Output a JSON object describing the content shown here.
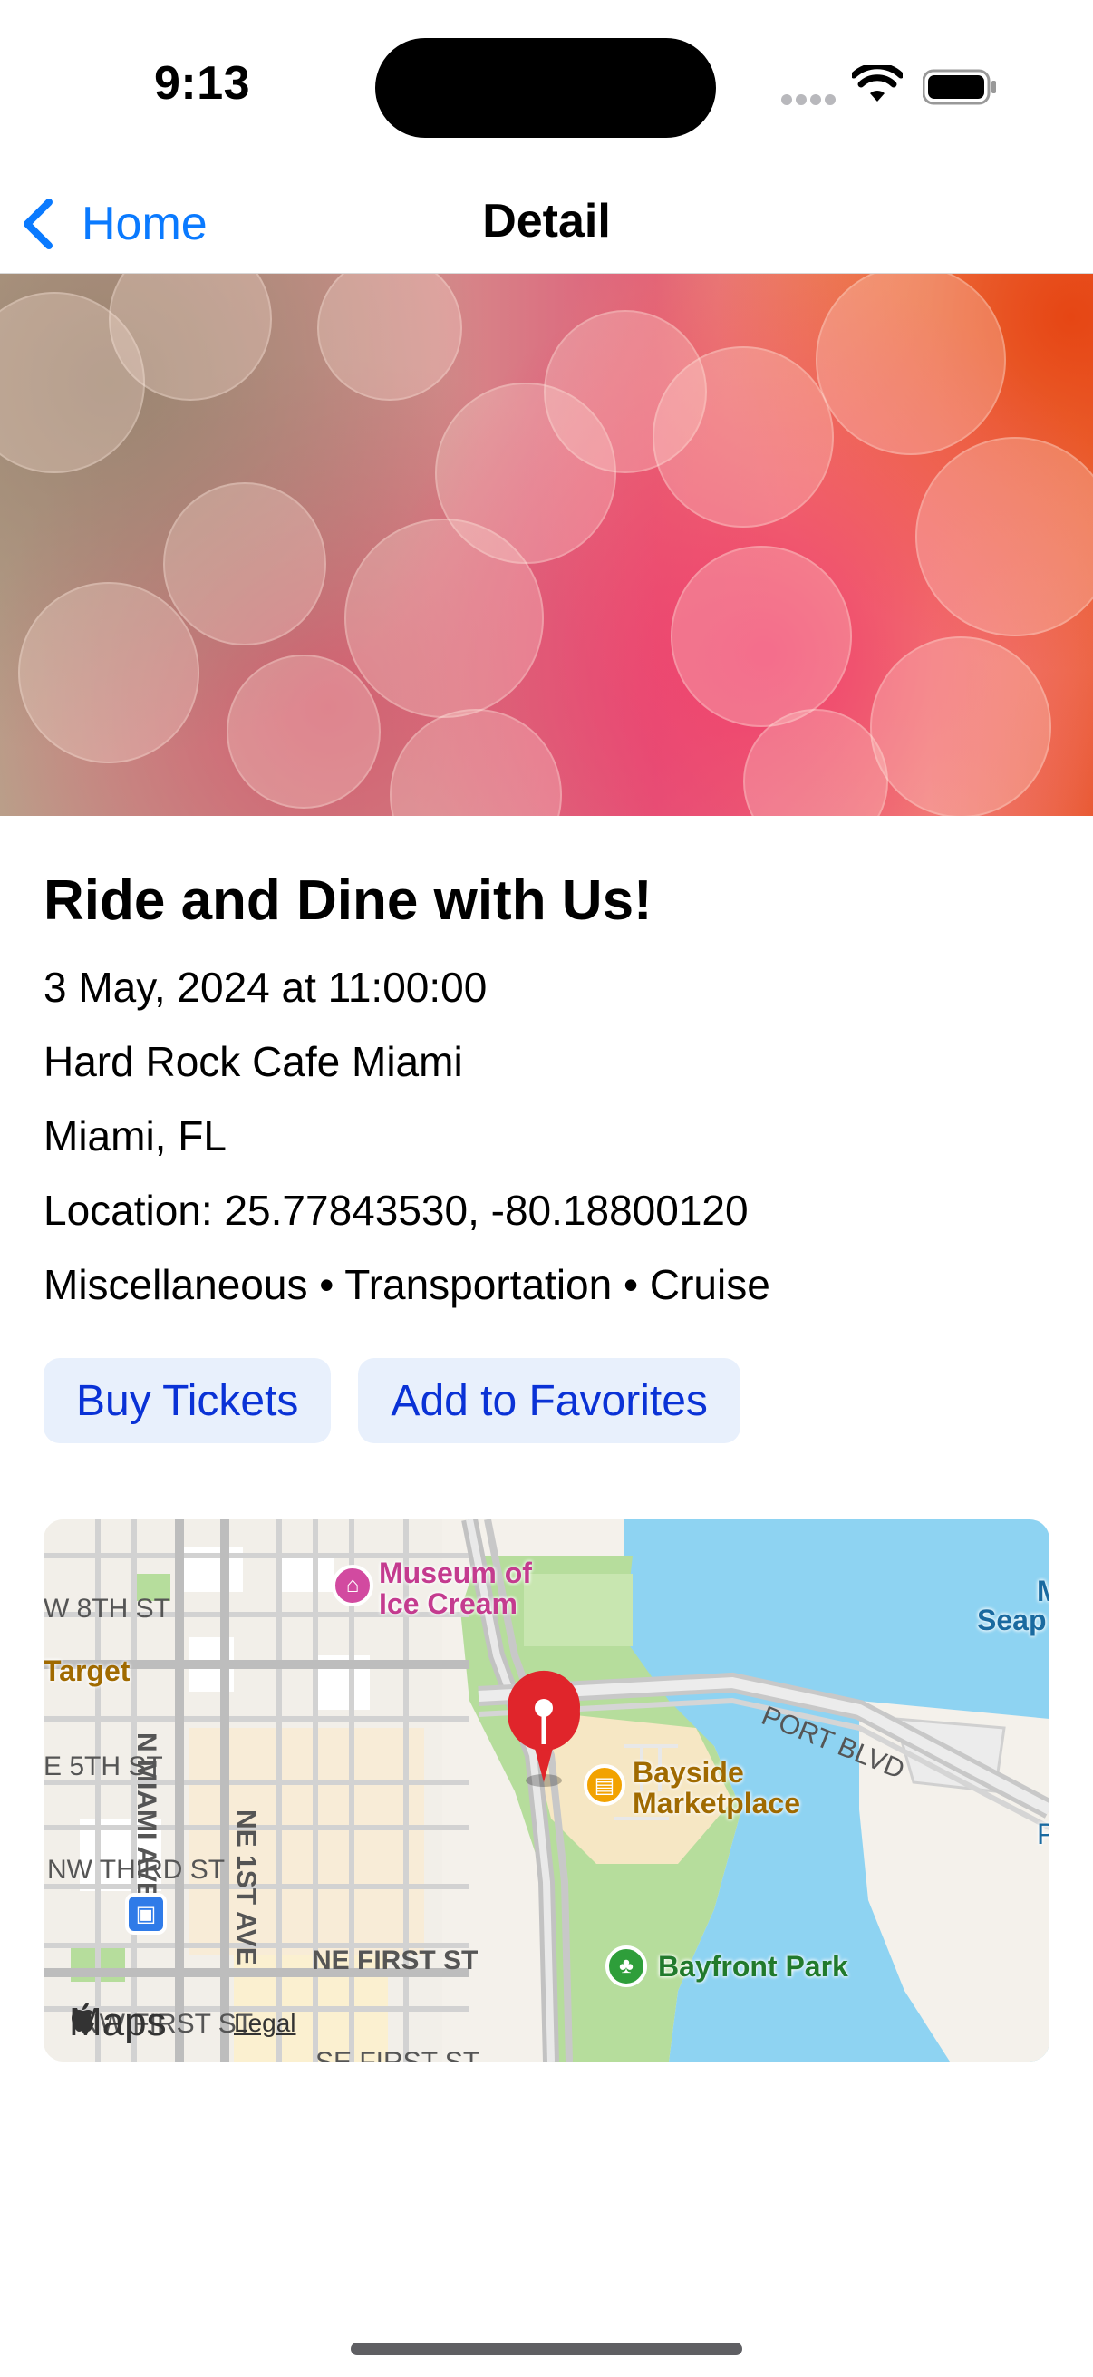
{
  "status_bar": {
    "time": "9:13",
    "icons": [
      "signal-dots-icon",
      "wifi-icon",
      "battery-icon"
    ]
  },
  "nav": {
    "back_label": "Home",
    "title": "Detail",
    "back_icon": "chevron-left-icon"
  },
  "event": {
    "title": "Ride and Dine with Us!",
    "date": "3 May, 2024 at 11:00:00",
    "venue": "Hard Rock Cafe Miami",
    "city": "Miami, FL",
    "location": "Location: 25.77843530, -80.18800120",
    "categories": "Miscellaneous • Transportation • Cruise"
  },
  "actions": {
    "buy_label": "Buy Tickets",
    "favorite_label": "Add to Favorites"
  },
  "map": {
    "streets": {
      "w8th": "W 8TH ST",
      "e5th": "E 5TH ST",
      "nwthird": "NW THIRD ST",
      "nmiami": "N MIAMI AVE",
      "ne1st_ave": "NE 1ST AVE",
      "nefirst": "NE FIRST ST",
      "sefirst": "SE FIRST ST",
      "nwfirst": "NW FIRST ST",
      "port": "PORT BLVD"
    },
    "pois": {
      "museum": "Museum of\nIce Cream",
      "target": "Target",
      "bayside": "Bayside\nMarketplace",
      "bayfront": "Bayfront Park",
      "seap": "Seap",
      "m": "M",
      "p": "P"
    },
    "logo": "Maps",
    "legal": "Legal",
    "colors": {
      "water": "#8ed3f2",
      "park": "#b6dd9c",
      "pin": "#e0252b"
    }
  }
}
